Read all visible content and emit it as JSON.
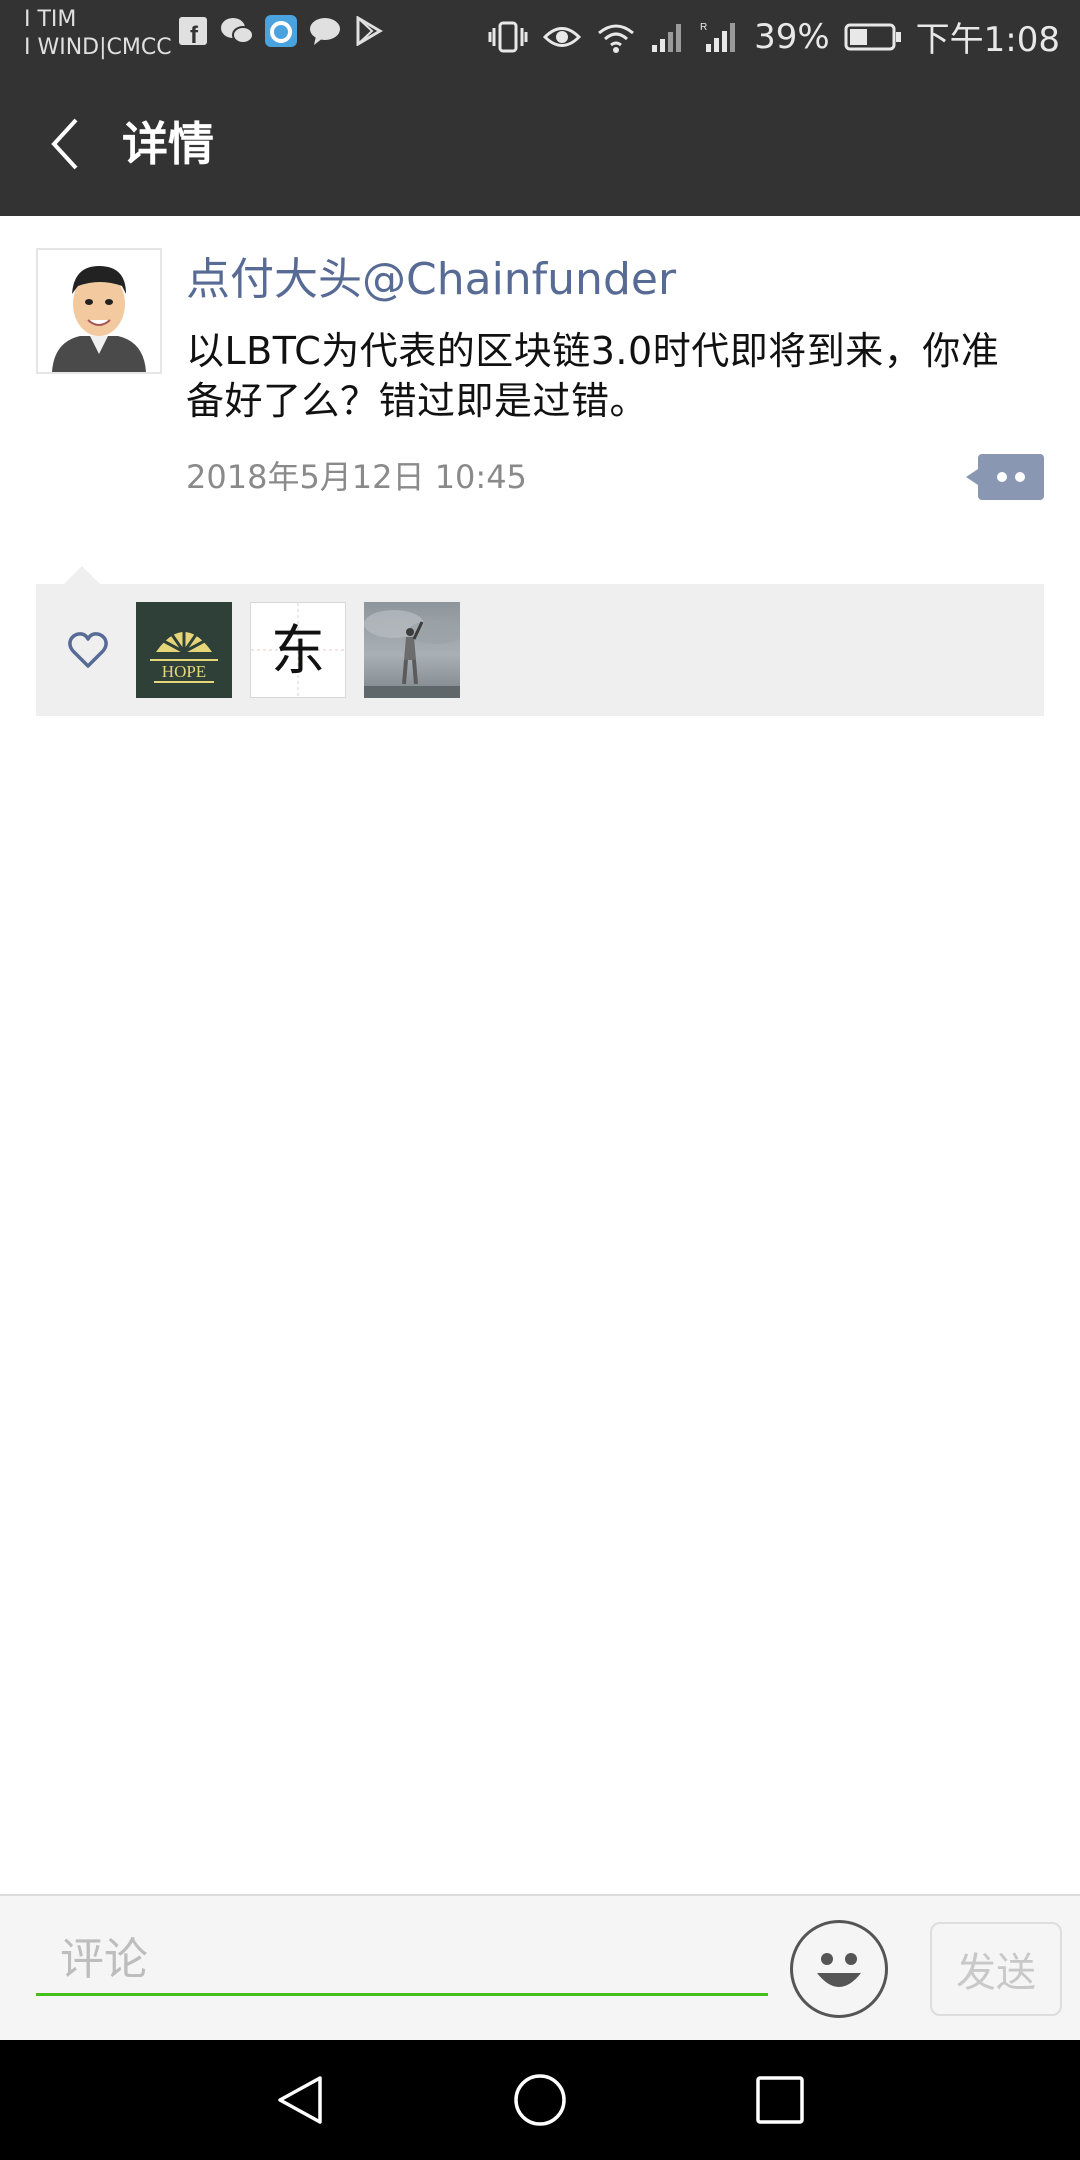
{
  "status_bar": {
    "carrier_1": "I TIM",
    "carrier_2": "I WIND|CMCC",
    "battery_percent": "39%",
    "time": "下午1:08",
    "app_icons": [
      "facebook-icon",
      "wechat-icon",
      "qq-browser-icon",
      "message-icon",
      "play-store-icon"
    ],
    "system_icons": [
      "vibrate-icon",
      "eye-icon",
      "wifi-icon",
      "signal-icon",
      "signal-roaming-icon",
      "battery-icon"
    ]
  },
  "header": {
    "title": "详情"
  },
  "post": {
    "author": "点付大头@Chainfunder",
    "content": "以LBTC为代表的区块链3.0时代即将到来，你准备好了么？错过即是过错。",
    "timestamp": "2018年5月12日 10:45"
  },
  "likes": {
    "avatars": [
      {
        "name": "hope-avatar",
        "text": "HOPE"
      },
      {
        "name": "dong-avatar",
        "text": "东"
      },
      {
        "name": "person-statue-avatar",
        "text": ""
      }
    ]
  },
  "comment": {
    "placeholder": "评论",
    "send_label": "发送"
  },
  "colors": {
    "header_bg": "#333333",
    "link_blue": "#576b95",
    "accent_green": "#45c01a",
    "likes_bg": "#efefef"
  }
}
